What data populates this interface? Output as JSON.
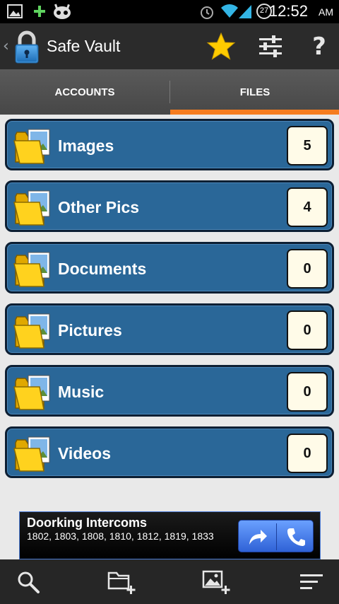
{
  "status_bar": {
    "time": "12:52",
    "ampm": "AM",
    "notification_badge": "27"
  },
  "action_bar": {
    "title": "Safe Vault"
  },
  "tabs": [
    {
      "label": "ACCOUNTS",
      "active": false
    },
    {
      "label": "FILES",
      "active": true
    }
  ],
  "folders": [
    {
      "name": "Images",
      "count": "5"
    },
    {
      "name": "Other Pics",
      "count": "4"
    },
    {
      "name": "Documents",
      "count": "0"
    },
    {
      "name": "Pictures",
      "count": "0"
    },
    {
      "name": "Music",
      "count": "0"
    },
    {
      "name": "Videos",
      "count": "0"
    }
  ],
  "ad": {
    "title": "Doorking Intercoms",
    "subtitle": "1802, 1803, 1808, 1810, 1812, 1819, 1833"
  },
  "colors": {
    "accent": "#f57c1f",
    "folder_row": "#2a6798",
    "star": "#ffcc00"
  }
}
